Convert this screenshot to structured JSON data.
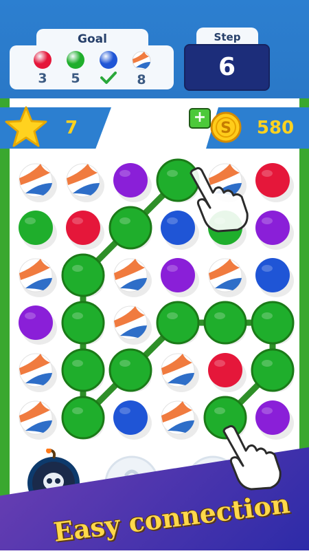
{
  "header": {
    "goal_label": "Goal",
    "goals": [
      {
        "ball": "red-ball",
        "color": "#e5173a",
        "count": "3",
        "completed": false
      },
      {
        "ball": "green-ball",
        "color": "#1fae2c",
        "count": "5",
        "completed": false
      },
      {
        "ball": "blue-ball",
        "color": "#1f55d6",
        "count": "",
        "completed": true
      },
      {
        "ball": "volleyball",
        "color": "#f07b3f",
        "count": "8",
        "completed": false
      }
    ],
    "step_label": "Step",
    "step_value": "6"
  },
  "stars": {
    "count": "7",
    "icon": "star-icon"
  },
  "coins": {
    "count": "580",
    "icon": "coin-icon",
    "add_icon": "plus-icon"
  },
  "board": {
    "rows": 6,
    "cols": 6,
    "cells": [
      [
        "volleyball",
        "volleyball",
        "purple",
        "green",
        "volleyball",
        "red"
      ],
      [
        "green",
        "red",
        "green",
        "blue",
        "green",
        "purple"
      ],
      [
        "volleyball",
        "green",
        "volleyball",
        "purple",
        "volleyball",
        "blue"
      ],
      [
        "purple",
        "green",
        "volleyball",
        "green",
        "green",
        "green"
      ],
      [
        "volleyball",
        "green",
        "green",
        "volleyball",
        "red",
        "green"
      ],
      [
        "volleyball",
        "green",
        "blue",
        "volleyball",
        "green",
        "purple"
      ]
    ],
    "connection_path": [
      [
        0,
        3
      ],
      [
        1,
        2
      ],
      [
        2,
        1
      ],
      [
        3,
        1
      ],
      [
        4,
        1
      ],
      [
        5,
        1
      ],
      [
        4,
        2
      ],
      [
        3,
        3
      ],
      [
        3,
        4
      ],
      [
        3,
        5
      ],
      [
        4,
        5
      ],
      [
        5,
        4
      ]
    ],
    "colors": {
      "green": "#1fae2c",
      "red": "#e5173a",
      "purple": "#8a1fd8",
      "blue": "#1f55d6",
      "volleyball": "#f07b3f"
    }
  },
  "boosters": [
    {
      "name": "bomb-booster",
      "icon": "skull-bomb-icon",
      "locked": false
    },
    {
      "name": "locked-booster-1",
      "icon": "lock-icon",
      "locked": true
    },
    {
      "name": "locked-booster-2",
      "icon": "lock-icon",
      "locked": true
    }
  ],
  "banner": {
    "text": "Easy connection"
  }
}
